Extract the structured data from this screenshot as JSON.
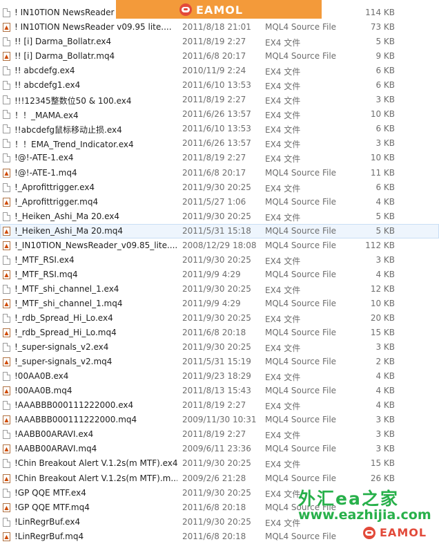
{
  "files": [
    {
      "name": "! IN10TION NewsReader",
      "date": "",
      "type": "",
      "size": "114 KB",
      "icon": "file-icon"
    },
    {
      "name": "! IN10TION NewsReader v09.95 lite....",
      "date": "2011/8/18 21:01",
      "type": "MQL4 Source File",
      "size": "73 KB",
      "icon": "mq4-icon"
    },
    {
      "name": "!! [i] Darma_Bollatr.ex4",
      "date": "2011/8/19 2:27",
      "type": "EX4 文件",
      "size": "5 KB",
      "icon": "file-icon"
    },
    {
      "name": "!! [i] Darma_Bollatr.mq4",
      "date": "2011/6/8 20:17",
      "type": "MQL4 Source File",
      "size": "9 KB",
      "icon": "mq4-icon"
    },
    {
      "name": "!! abcdefg.ex4",
      "date": "2010/11/9 2:24",
      "type": "EX4 文件",
      "size": "6 KB",
      "icon": "file-icon"
    },
    {
      "name": "!! abcdefg1.ex4",
      "date": "2011/6/10 13:53",
      "type": "EX4 文件",
      "size": "6 KB",
      "icon": "file-icon"
    },
    {
      "name": "!!!12345整数位50 & 100.ex4",
      "date": "2011/8/19 2:27",
      "type": "EX4 文件",
      "size": "3 KB",
      "icon": "file-icon"
    },
    {
      "name": "！！_MAMA.ex4",
      "date": "2011/6/26 13:57",
      "type": "EX4 文件",
      "size": "10 KB",
      "icon": "file-icon"
    },
    {
      "name": "!!abcdefg鼠标移动止损.ex4",
      "date": "2011/6/10 13:53",
      "type": "EX4 文件",
      "size": "6 KB",
      "icon": "file-icon"
    },
    {
      "name": "！！EMA_Trend_Indicator.ex4",
      "date": "2011/6/26 13:57",
      "type": "EX4 文件",
      "size": "3 KB",
      "icon": "file-icon"
    },
    {
      "name": "!@!-ATE-1.ex4",
      "date": "2011/8/19 2:27",
      "type": "EX4 文件",
      "size": "10 KB",
      "icon": "file-icon"
    },
    {
      "name": "!@!-ATE-1.mq4",
      "date": "2011/6/8 20:17",
      "type": "MQL4 Source File",
      "size": "11 KB",
      "icon": "mq4-icon"
    },
    {
      "name": "!_Aprofittrigger.ex4",
      "date": "2011/9/30 20:25",
      "type": "EX4 文件",
      "size": "6 KB",
      "icon": "file-icon"
    },
    {
      "name": "!_Aprofittrigger.mq4",
      "date": "2011/5/27 1:06",
      "type": "MQL4 Source File",
      "size": "4 KB",
      "icon": "mq4-icon"
    },
    {
      "name": "!_Heiken_Ashi_Ma 20.ex4",
      "date": "2011/9/30 20:25",
      "type": "EX4 文件",
      "size": "5 KB",
      "icon": "file-icon"
    },
    {
      "name": "!_Heiken_Ashi_Ma 20.mq4",
      "date": "2011/5/31 15:18",
      "type": "MQL4 Source File",
      "size": "5 KB",
      "icon": "mq4-icon",
      "selected": true
    },
    {
      "name": "!_IN10TION_NewsReader_v09.85_lite....",
      "date": "2008/12/29 18:08",
      "type": "MQL4 Source File",
      "size": "112 KB",
      "icon": "mq4-icon"
    },
    {
      "name": "!_MTF_RSI.ex4",
      "date": "2011/9/30 20:25",
      "type": "EX4 文件",
      "size": "3 KB",
      "icon": "file-icon"
    },
    {
      "name": "!_MTF_RSI.mq4",
      "date": "2011/9/9 4:29",
      "type": "MQL4 Source File",
      "size": "4 KB",
      "icon": "mq4-icon"
    },
    {
      "name": "!_MTF_shi_channel_1.ex4",
      "date": "2011/9/30 20:25",
      "type": "EX4 文件",
      "size": "12 KB",
      "icon": "file-icon"
    },
    {
      "name": "!_MTF_shi_channel_1.mq4",
      "date": "2011/9/9 4:29",
      "type": "MQL4 Source File",
      "size": "10 KB",
      "icon": "mq4-icon"
    },
    {
      "name": "!_rdb_Spread_Hi_Lo.ex4",
      "date": "2011/9/30 20:25",
      "type": "EX4 文件",
      "size": "20 KB",
      "icon": "file-icon"
    },
    {
      "name": "!_rdb_Spread_Hi_Lo.mq4",
      "date": "2011/6/8 20:18",
      "type": "MQL4 Source File",
      "size": "15 KB",
      "icon": "mq4-icon"
    },
    {
      "name": "!_super-signals_v2.ex4",
      "date": "2011/9/30 20:25",
      "type": "EX4 文件",
      "size": "3 KB",
      "icon": "file-icon"
    },
    {
      "name": "!_super-signals_v2.mq4",
      "date": "2011/5/31 15:19",
      "type": "MQL4 Source File",
      "size": "2 KB",
      "icon": "mq4-icon"
    },
    {
      "name": "!00AA0B.ex4",
      "date": "2011/9/23 18:29",
      "type": "EX4 文件",
      "size": "4 KB",
      "icon": "file-icon"
    },
    {
      "name": "!00AA0B.mq4",
      "date": "2011/8/13 15:43",
      "type": "MQL4 Source File",
      "size": "4 KB",
      "icon": "mq4-icon"
    },
    {
      "name": "!AAABBB000111222000.ex4",
      "date": "2011/8/19 2:27",
      "type": "EX4 文件",
      "size": "4 KB",
      "icon": "file-icon"
    },
    {
      "name": "!AAABBB000111222000.mq4",
      "date": "2009/11/30 10:31",
      "type": "MQL4 Source File",
      "size": "3 KB",
      "icon": "mq4-icon"
    },
    {
      "name": "!AABB00ARAVI.ex4",
      "date": "2011/8/19 2:27",
      "type": "EX4 文件",
      "size": "3 KB",
      "icon": "file-icon"
    },
    {
      "name": "!AABB00ARAVI.mq4",
      "date": "2009/6/11 23:36",
      "type": "MQL4 Source File",
      "size": "3 KB",
      "icon": "mq4-icon"
    },
    {
      "name": "!Chin Breakout Alert V.1.2s(m MTF).ex4",
      "date": "2011/9/30 20:25",
      "type": "EX4 文件",
      "size": "15 KB",
      "icon": "file-icon"
    },
    {
      "name": "!Chin Breakout Alert V.1.2s(m MTF).m...",
      "date": "2009/2/6 21:28",
      "type": "MQL4 Source File",
      "size": "26 KB",
      "icon": "mq4-icon"
    },
    {
      "name": "!GP QQE MTF.ex4",
      "date": "2011/9/30 20:25",
      "type": "EX4 文件",
      "size": "",
      "icon": "file-icon"
    },
    {
      "name": "!GP QQE MTF.mq4",
      "date": "2011/6/8 20:18",
      "type": "MQL4 Source File",
      "size": "",
      "icon": "mq4-icon"
    },
    {
      "name": "!LinRegrBuf.ex4",
      "date": "2011/9/30 20:25",
      "type": "EX4 文件",
      "size": "",
      "icon": "file-icon"
    },
    {
      "name": "!LinRegrBuf.mq4",
      "date": "2011/6/8 20:18",
      "type": "MQL4 Source File",
      "size": "",
      "icon": "mq4-icon"
    }
  ],
  "branding": {
    "logo_text": "EAMOL",
    "watermark_cn": "外汇ea之家",
    "watermark_url": "www.eazhijia.com"
  },
  "colors": {
    "banner": "#f39a3a",
    "logo_red": "#e24a3a",
    "watermark_green": "#27b04a",
    "selected_row": "#eef5fd"
  }
}
